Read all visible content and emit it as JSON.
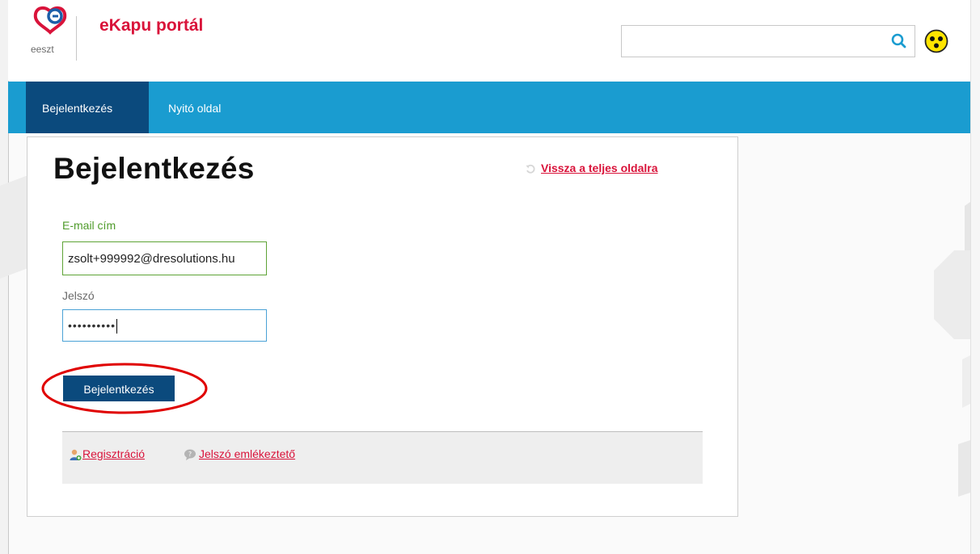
{
  "header": {
    "logo_text": "eeszt",
    "portal_title": "eKapu portál",
    "search": {
      "value": "",
      "placeholder": ""
    }
  },
  "nav": {
    "items": [
      {
        "label": "Bejelentkezés",
        "active": true
      },
      {
        "label": "Nyitó oldal",
        "active": false
      }
    ]
  },
  "login": {
    "title": "Bejelentkezés",
    "back_link": "Vissza a teljes oldalra",
    "email_label": "E-mail cím",
    "email_value": "zsolt+999992@dresolutions.hu",
    "password_label": "Jelszó",
    "password_masked": "••••••••••",
    "submit_label": "Bejelentkezés",
    "footer_links": {
      "register": "Regisztráció",
      "password_reminder": "Jelszó emlékeztető"
    }
  },
  "colors": {
    "brand_red": "#d9133a",
    "nav_blue": "#1a9cd0",
    "nav_active": "#0b4a7d",
    "valid_green": "#5ea336",
    "highlight_circle": "#e00000"
  }
}
